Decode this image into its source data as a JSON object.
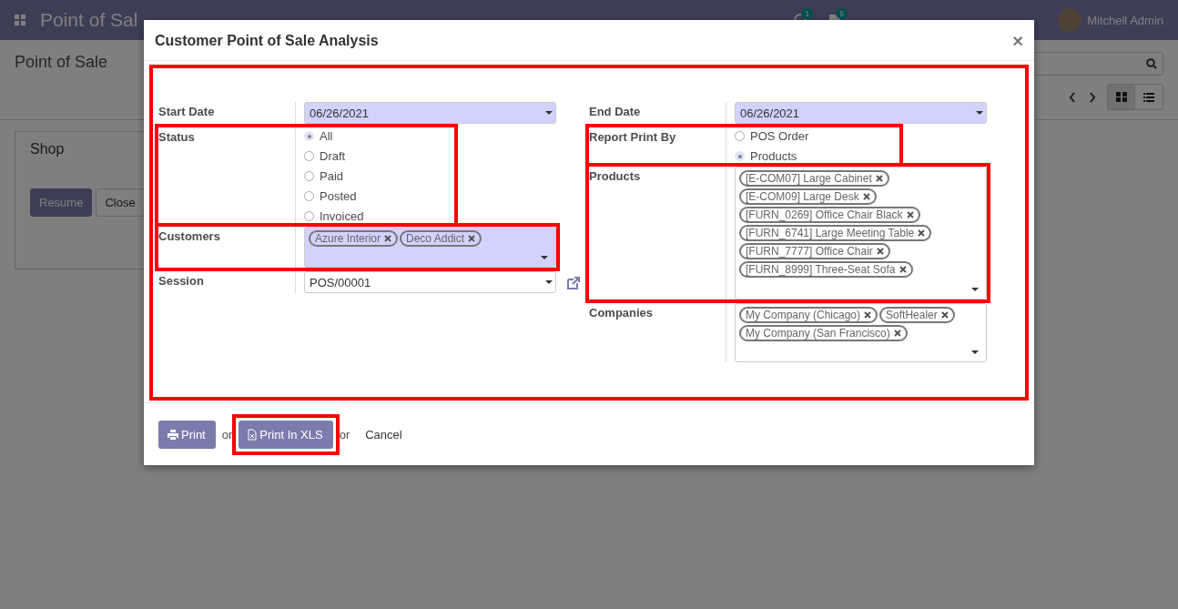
{
  "navbar": {
    "app_title": "Point of Sal",
    "activity_count": "1",
    "message_count": "5",
    "user": "Mitchell Admin"
  },
  "control_panel": {
    "breadcrumb": "Point of Sale"
  },
  "card": {
    "title": "Shop",
    "buttons": [
      {
        "kind": "primary",
        "label": "Resume"
      },
      {
        "kind": "secondary",
        "label": "Close"
      }
    ]
  },
  "dialog": {
    "title": "Customer Point of Sale Analysis",
    "close": "×",
    "highlighted": true,
    "left_fields": [
      {
        "kind": "date",
        "label": "Start Date",
        "value": "06/26/2021",
        "required": true,
        "highlighted": false
      },
      {
        "kind": "radio",
        "label": "Status",
        "highlighted": true,
        "options": [
          {
            "label": "All",
            "selected": true
          },
          {
            "label": "Draft",
            "selected": false
          },
          {
            "label": "Paid",
            "selected": false
          },
          {
            "label": "Posted",
            "selected": false
          },
          {
            "label": "Invoiced",
            "selected": false
          }
        ]
      },
      {
        "kind": "tags",
        "label": "Customers",
        "required": true,
        "highlighted": true,
        "tags": [
          "Azure Interior",
          "Deco Addict"
        ]
      },
      {
        "kind": "select",
        "label": "Session",
        "value": "POS/00001",
        "required": false,
        "highlighted": false
      }
    ],
    "right_fields": [
      {
        "kind": "date",
        "label": "End Date",
        "value": "06/26/2021",
        "required": true,
        "highlighted": false
      },
      {
        "kind": "radio",
        "label": "Report Print By",
        "highlighted": true,
        "options": [
          {
            "label": "POS Order",
            "selected": false
          },
          {
            "label": "Products",
            "selected": true
          }
        ]
      },
      {
        "kind": "tags",
        "label": "Products",
        "required": false,
        "highlighted": true,
        "tags": [
          "[E-COM07] Large Cabinet",
          "[E-COM09] Large Desk",
          "[FURN_0269] Office Chair Black",
          "[FURN_6741] Large Meeting Table",
          "[FURN_7777] Office Chair",
          "[FURN_8999] Three-Seat Sofa"
        ]
      },
      {
        "kind": "tags",
        "label": "Companies",
        "required": false,
        "highlighted": false,
        "tags": [
          "My Company (Chicago)",
          "SoftHealer",
          "My Company (San Francisco)"
        ]
      }
    ],
    "footer": [
      {
        "kind": "button",
        "label": "Print",
        "highlighted": false
      },
      {
        "kind": "text",
        "label": "or"
      },
      {
        "kind": "button",
        "label": "Print In XLS",
        "highlighted": true
      },
      {
        "kind": "text",
        "label": "or"
      },
      {
        "kind": "link",
        "label": "Cancel"
      }
    ]
  }
}
